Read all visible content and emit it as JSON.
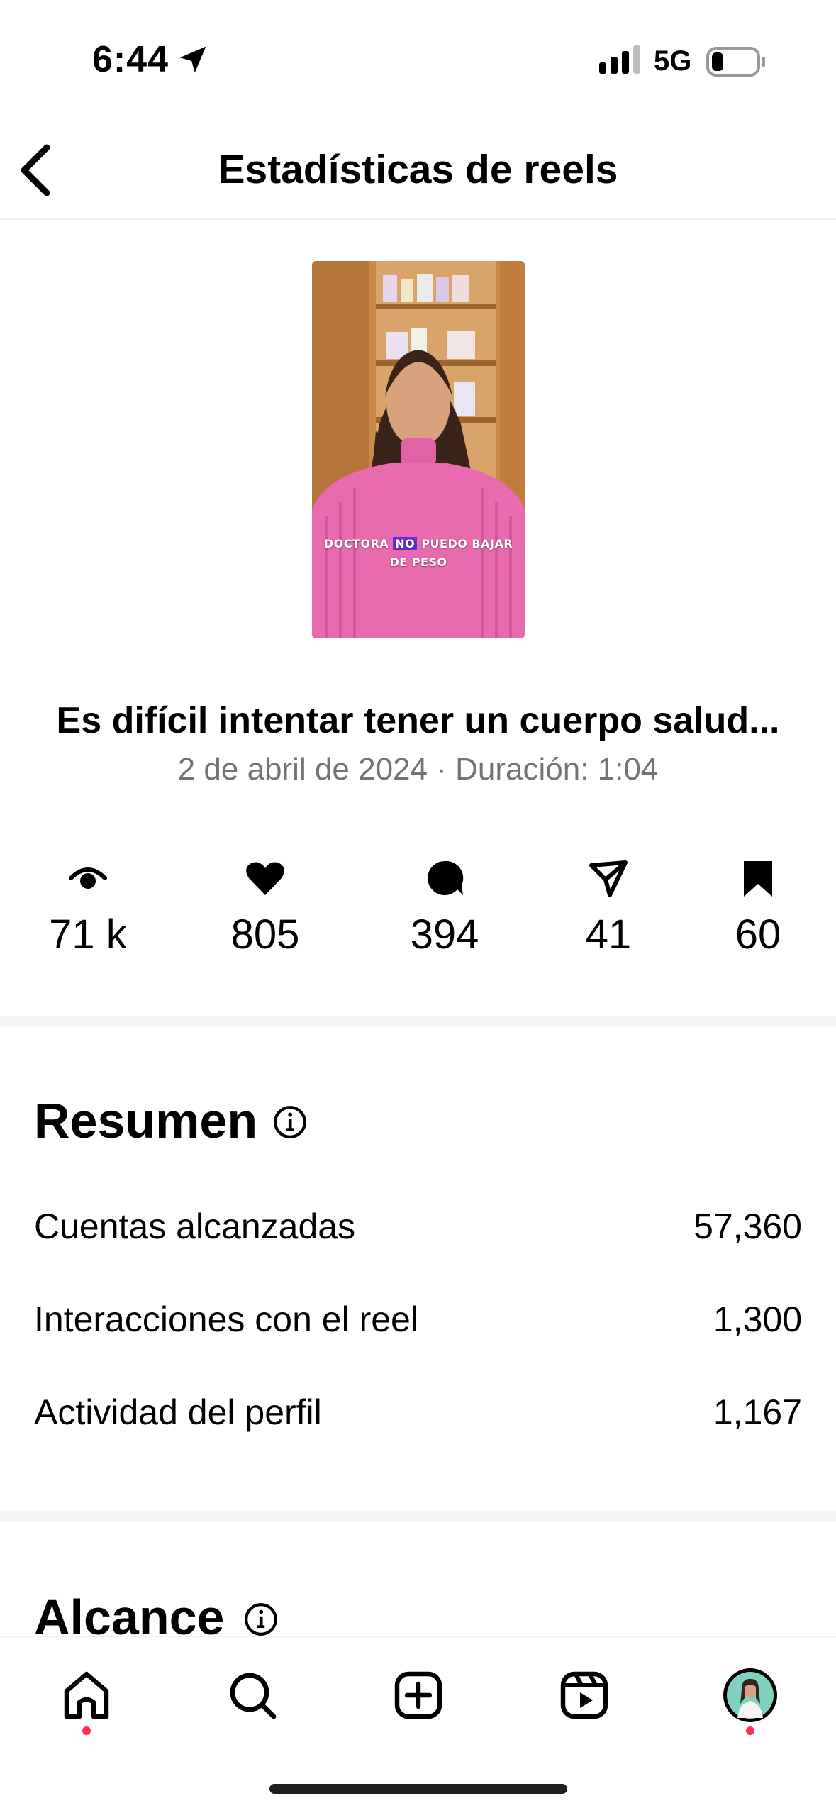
{
  "status_bar": {
    "time": "6:44",
    "network": "5G"
  },
  "header": {
    "title": "Estadísticas de reels"
  },
  "reel": {
    "thumbnail_caption_1": "DOCTORA",
    "thumbnail_caption_highlight": "NO",
    "thumbnail_caption_2": "PUEDO BAJAR",
    "thumbnail_caption_3": "DE PESO",
    "title": "Es difícil intentar tener un cuerpo salud...",
    "meta": "2 de abril de 2024 · Duración: 1:04"
  },
  "metrics": [
    {
      "icon": "eye-icon",
      "value": "71 k"
    },
    {
      "icon": "heart-icon",
      "value": "805"
    },
    {
      "icon": "comment-icon",
      "value": "394"
    },
    {
      "icon": "share-icon",
      "value": "41"
    },
    {
      "icon": "bookmark-icon",
      "value": "60"
    }
  ],
  "summary": {
    "title": "Resumen",
    "rows": [
      {
        "label": "Cuentas alcanzadas",
        "value": "57,360"
      },
      {
        "label": "Interacciones con el reel",
        "value": "1,300"
      },
      {
        "label": "Actividad del perfil",
        "value": "1,167"
      }
    ]
  },
  "reach": {
    "title": "Alcance"
  },
  "tabbar": {
    "items": [
      "home-icon",
      "search-icon",
      "create-icon",
      "reels-icon",
      "profile-avatar"
    ]
  },
  "colors": {
    "accent_dot": "#ff2d55",
    "muted_text": "#737373",
    "caption_highlight": "#6a2bd8"
  }
}
